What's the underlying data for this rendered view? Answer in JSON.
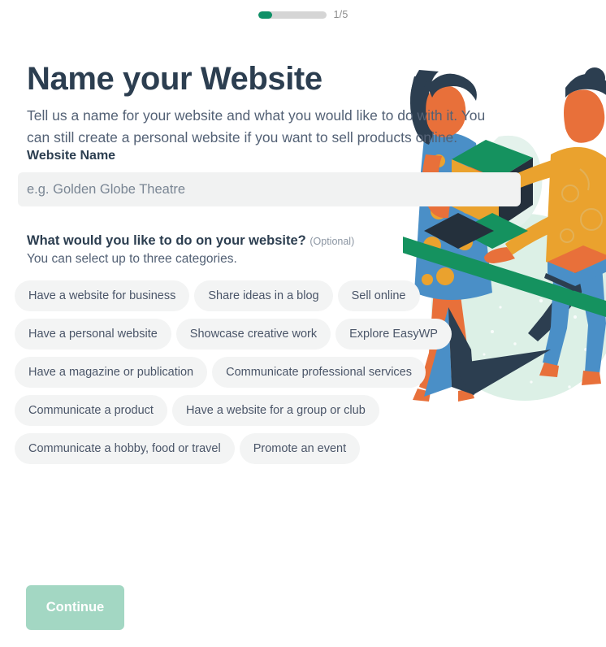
{
  "progress": {
    "current_step": 1,
    "total_steps": 5,
    "label": "1/5",
    "fill_percent": 21,
    "fill_color": "#0f9167",
    "track_color": "#d5d5d5"
  },
  "page": {
    "title": "Name your Website",
    "subtitle": "Tell us a name for your website and what you would like to do with it. You can still create a personal website if you want to sell products online.",
    "title_color": "#2c3e50"
  },
  "website_name_field": {
    "label": "Website Name",
    "value": "",
    "placeholder": "e.g. Golden Globe Theatre",
    "background": "#f1f2f2"
  },
  "categories": {
    "heading": "What would you like to do on your website?",
    "optional_tag": "(Optional)",
    "hint": "You can select up to three categories.",
    "max_selectable": 3,
    "chip_background": "#f3f4f4",
    "options": [
      {
        "label": "Have a website for business",
        "selected": false
      },
      {
        "label": "Share ideas in a blog",
        "selected": false
      },
      {
        "label": "Sell online",
        "selected": false
      },
      {
        "label": "Have a personal website",
        "selected": false
      },
      {
        "label": "Showcase creative work",
        "selected": false
      },
      {
        "label": "Explore EasyWP",
        "selected": false
      },
      {
        "label": "Have a magazine or publication",
        "selected": false
      },
      {
        "label": "Communicate professional services",
        "selected": false
      },
      {
        "label": "Communicate a product",
        "selected": false
      },
      {
        "label": "Have a website for a group or club",
        "selected": false
      },
      {
        "label": "Communicate a hobby, food or travel",
        "selected": false
      },
      {
        "label": "Promote an event",
        "selected": false
      }
    ]
  },
  "continue_button": {
    "label": "Continue",
    "enabled": false,
    "color": "#a3d7c3",
    "text_color": "#ffffff"
  },
  "illustration": {
    "name": "people-with-boxes-illustration",
    "palette": {
      "green": "#15925f",
      "mint": "#dcf0e6",
      "navy": "#2c3e50",
      "blue": "#4a8fc7",
      "orange": "#e8703a",
      "yellow": "#eaa22e",
      "skin": "#e8703a"
    }
  }
}
